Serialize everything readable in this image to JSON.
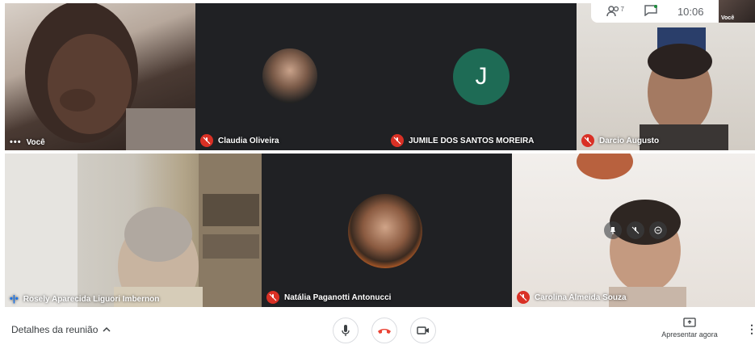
{
  "topbar": {
    "participants_count": "7",
    "time": "10:06",
    "self_label": "Você"
  },
  "tiles": [
    {
      "id": "voce",
      "name": "Você",
      "has_menu_dots": true
    },
    {
      "id": "claudia",
      "name": "Claudia Oliveira",
      "muted": true
    },
    {
      "id": "jumile",
      "name": "JUMILE DOS SANTOS MOREIRA",
      "muted": true,
      "avatar_letter": "J",
      "avatar_color": "#1e6b55"
    },
    {
      "id": "darcio",
      "name": "Darcio Augusto",
      "muted": true
    },
    {
      "id": "rosely",
      "name": "Rosely Aparecida Liguori Imbernon",
      "speaking": true
    },
    {
      "id": "natalia",
      "name": "Natália Paganotti Antonucci",
      "muted": true
    },
    {
      "id": "carolina",
      "name": "Carolina Almeida Souza",
      "muted": true
    }
  ],
  "bottom": {
    "details_label": "Detalhes da reunião",
    "present_label": "Apresentar agora"
  },
  "icons": {
    "people": "people-icon",
    "chat": "chat-icon",
    "mic": "mic-icon",
    "hangup": "hangup-icon",
    "camera": "camera-icon",
    "present": "present-icon",
    "more": "more-vert-icon"
  },
  "colors": {
    "mute_red": "#d93025",
    "hangup_red": "#ea4335",
    "tile_dark": "#202124"
  }
}
